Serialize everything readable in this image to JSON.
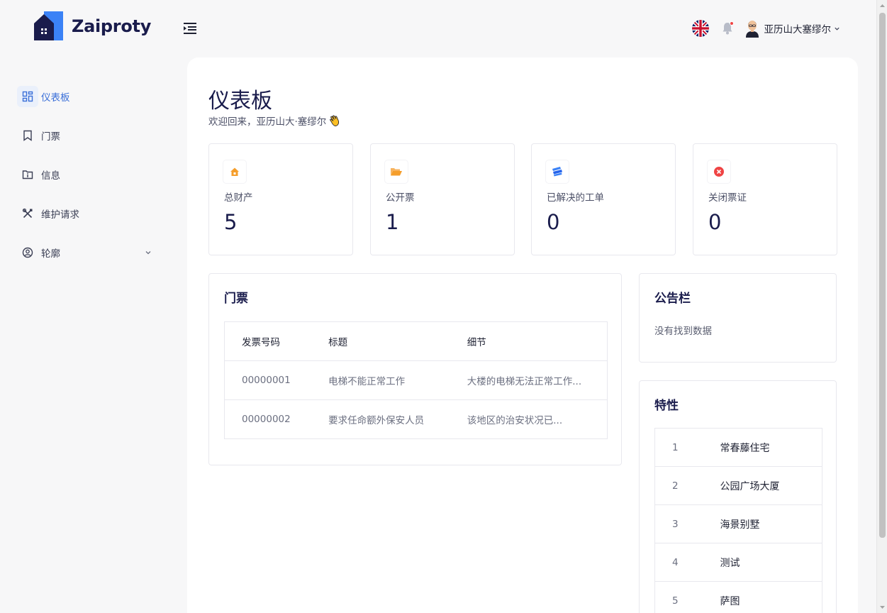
{
  "brand": {
    "name": "Zaiproty"
  },
  "header": {
    "user_name": "亚历山大塞缪尔"
  },
  "sidebar": {
    "items": [
      {
        "label": "仪表板",
        "icon": "dashboard-icon",
        "active": true
      },
      {
        "label": "门票",
        "icon": "bookmark-icon"
      },
      {
        "label": "信息",
        "icon": "folder-info-icon"
      },
      {
        "label": "维护请求",
        "icon": "tools-icon"
      },
      {
        "label": "轮廓",
        "icon": "user-circle-icon",
        "expandable": true
      }
    ]
  },
  "page": {
    "title": "仪表板",
    "welcome": "欢迎回来，亚历山大·塞缪尔"
  },
  "stats": [
    {
      "label": "总财产",
      "value": "5",
      "icon": "home-icon",
      "color": "#f59e2b"
    },
    {
      "label": "公开票",
      "value": "1",
      "icon": "folder-open-icon",
      "color": "#f59e2b"
    },
    {
      "label": "已解决的工单",
      "value": "0",
      "icon": "tickets-icon",
      "color": "#3b82f6"
    },
    {
      "label": "关闭票证",
      "value": "0",
      "icon": "close-circle-icon",
      "color": "#ef4444"
    }
  ],
  "tickets": {
    "title": "门票",
    "columns": [
      "发票号码",
      "标题",
      "细节"
    ],
    "rows": [
      [
        "00000001",
        "电梯不能正常工作",
        "大楼的电梯无法正常工作..."
      ],
      [
        "00000002",
        "要求任命额外保安人员",
        "该地区的治安状况已..."
      ]
    ]
  },
  "notice": {
    "title": "公告栏",
    "empty": "没有找到数据"
  },
  "properties": {
    "title": "特性",
    "rows": [
      [
        "1",
        "常春藤住宅"
      ],
      [
        "2",
        "公园广场大厦"
      ],
      [
        "3",
        "海景别墅"
      ],
      [
        "4",
        "测试"
      ],
      [
        "5",
        "萨图"
      ]
    ]
  },
  "colors": {
    "accent": "#3a6fd8",
    "brand_dark": "#1a1c4c",
    "brand_blue": "#3b82f6"
  }
}
